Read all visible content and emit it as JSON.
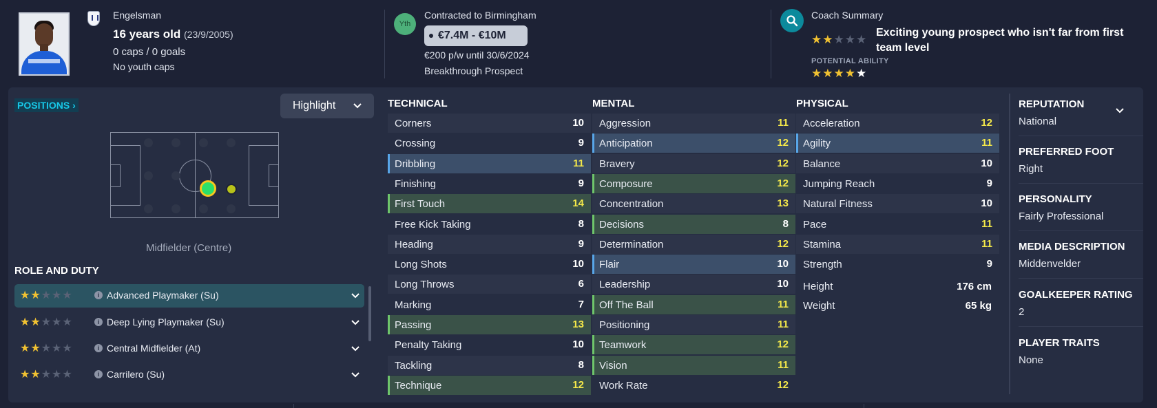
{
  "header": {
    "name": "Engelsman",
    "age": "16 years old",
    "dob": "(23/9/2005)",
    "caps": "0 caps / 0 goals",
    "youth_caps": "No youth caps",
    "contract_badge": "Yth",
    "contract": "Contracted to Birmingham",
    "value": "€7.4M - €10M",
    "wage": "€200 p/w until 30/6/2024",
    "status": "Breakthrough Prospect",
    "coach_title": "Coach Summary",
    "coach_summary": "Exciting young prospect who isn't far from first team level",
    "current_ability_stars": 2,
    "potential_label": "POTENTIAL ABILITY",
    "potential_stars": 4.5
  },
  "positions": {
    "button": "POSITIONS",
    "highlight": "Highlight",
    "position_label": "Midfielder (Centre)"
  },
  "roles": {
    "heading": "ROLE AND DUTY",
    "items": [
      {
        "name": "Advanced Playmaker (Su)",
        "stars": 2
      },
      {
        "name": "Deep Lying Playmaker (Su)",
        "stars": 2
      },
      {
        "name": "Central Midfielder (At)",
        "stars": 2
      },
      {
        "name": "Carrilero (Su)",
        "stars": 2
      }
    ]
  },
  "technical": {
    "heading": "TECHNICAL",
    "items": [
      {
        "name": "Corners",
        "value": "10"
      },
      {
        "name": "Crossing",
        "value": "9"
      },
      {
        "name": "Dribbling",
        "value": "11"
      },
      {
        "name": "Finishing",
        "value": "9"
      },
      {
        "name": "First Touch",
        "value": "14"
      },
      {
        "name": "Free Kick Taking",
        "value": "8"
      },
      {
        "name": "Heading",
        "value": "9"
      },
      {
        "name": "Long Shots",
        "value": "10"
      },
      {
        "name": "Long Throws",
        "value": "6"
      },
      {
        "name": "Marking",
        "value": "7"
      },
      {
        "name": "Passing",
        "value": "13"
      },
      {
        "name": "Penalty Taking",
        "value": "10"
      },
      {
        "name": "Tackling",
        "value": "8"
      },
      {
        "name": "Technique",
        "value": "12"
      }
    ]
  },
  "mental": {
    "heading": "MENTAL",
    "items": [
      {
        "name": "Aggression",
        "value": "11"
      },
      {
        "name": "Anticipation",
        "value": "12"
      },
      {
        "name": "Bravery",
        "value": "12"
      },
      {
        "name": "Composure",
        "value": "12"
      },
      {
        "name": "Concentration",
        "value": "13"
      },
      {
        "name": "Decisions",
        "value": "8"
      },
      {
        "name": "Determination",
        "value": "12"
      },
      {
        "name": "Flair",
        "value": "10"
      },
      {
        "name": "Leadership",
        "value": "10"
      },
      {
        "name": "Off The Ball",
        "value": "11"
      },
      {
        "name": "Positioning",
        "value": "11"
      },
      {
        "name": "Teamwork",
        "value": "12"
      },
      {
        "name": "Vision",
        "value": "11"
      },
      {
        "name": "Work Rate",
        "value": "12"
      }
    ]
  },
  "physical": {
    "heading": "PHYSICAL",
    "items": [
      {
        "name": "Acceleration",
        "value": "12"
      },
      {
        "name": "Agility",
        "value": "11"
      },
      {
        "name": "Balance",
        "value": "10"
      },
      {
        "name": "Jumping Reach",
        "value": "9"
      },
      {
        "name": "Natural Fitness",
        "value": "10"
      },
      {
        "name": "Pace",
        "value": "11"
      },
      {
        "name": "Stamina",
        "value": "11"
      },
      {
        "name": "Strength",
        "value": "9"
      }
    ],
    "height_label": "Height",
    "height": "176 cm",
    "weight_label": "Weight",
    "weight": "65 kg"
  },
  "info": {
    "reputation_label": "REPUTATION",
    "reputation": "National",
    "foot_label": "PREFERRED FOOT",
    "foot": "Right",
    "personality_label": "PERSONALITY",
    "personality": "Fairly Professional",
    "media_label": "MEDIA DESCRIPTION",
    "media": "Middenvelder",
    "gk_label": "GOALKEEPER RATING",
    "gk": "2",
    "traits_label": "PLAYER TRAITS",
    "traits": "None"
  },
  "colors": {
    "background": "#1d2235",
    "panel": "#262d42",
    "accent_cyan": "#17c8e8",
    "star": "#f1c232",
    "value_yellow": "#f4e84a",
    "highlight_green": "#3a5248",
    "highlight_blue": "#3c4f6a"
  }
}
